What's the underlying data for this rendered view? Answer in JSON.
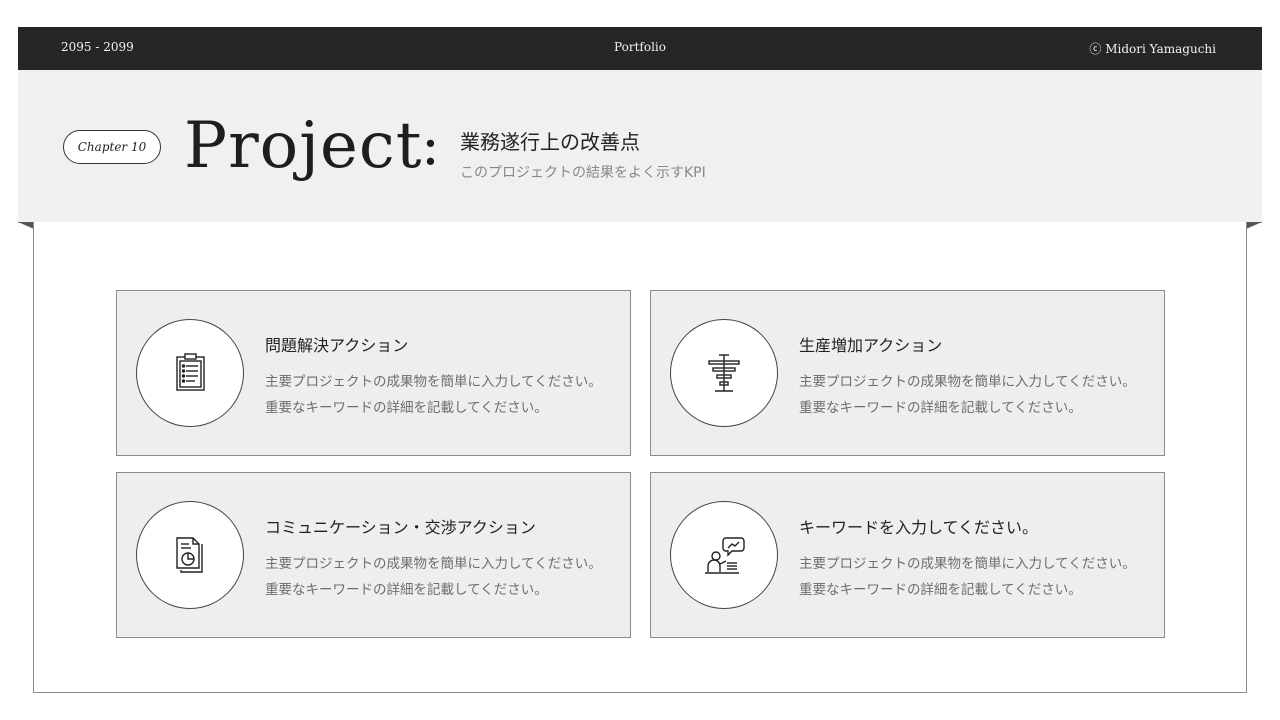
{
  "topbar": {
    "years": "2095 - 2099",
    "title": "Portfolio",
    "author": "ⓒ Midori Yamaguchi"
  },
  "header": {
    "chapter": "Chapter 10",
    "heading": "Project",
    "colon": ":",
    "subtitle": "業務遂行上の改善点",
    "description": "このプロジェクトの結果をよく示すKPI"
  },
  "cards": [
    {
      "icon": "clipboard-checklist-icon",
      "title": "問題解決アクション",
      "text": "主要プロジェクトの成果物を簡単に入力してください。 重要なキーワードの詳細を記載してください。"
    },
    {
      "icon": "bar-gauge-icon",
      "title": "生産増加アクション",
      "text": "主要プロジェクトの成果物を簡単に入力してください。 重要なキーワードの詳細を記載してください。"
    },
    {
      "icon": "document-pie-chart-icon",
      "title": "コミュニケーション・交渉アクション",
      "text": "主要プロジェクトの成果物を簡単に入力してください。 重要なキーワードの詳細を記載してください。"
    },
    {
      "icon": "presenter-chat-icon",
      "title": "キーワードを入力してください。",
      "text": "主要プロジェクトの成果物を簡単に入力してください。 重要なキーワードの詳細を記載してください。"
    }
  ]
}
